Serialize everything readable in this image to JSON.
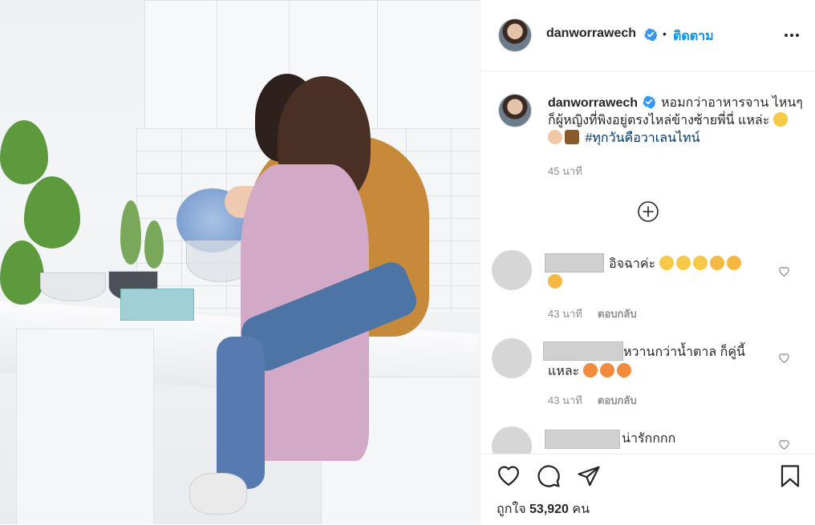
{
  "post": {
    "username": "danworrawech",
    "follow_label": "ติดตาม",
    "separator": "•"
  },
  "caption": {
    "username": "danworrawech",
    "text": "หอมกว่าอาหารจาน ไหนๆ ก็ผู้หญิงที่พิงอยู่ตรงไหล่ข้างซ้ายพี่นี่ แหล่ะ",
    "emojis": [
      "grinning-face",
      "clapping-hands",
      "party-popper"
    ],
    "hashtag": "#ทุกวันคือวาเลนไทน์",
    "time": "45 นาที"
  },
  "comments": [
    {
      "text": "อิจฉาค่ะ",
      "emojis": [
        "rofl",
        "rofl",
        "rofl",
        "grin",
        "grin",
        "grin"
      ],
      "time": "43 นาที",
      "reply": "ตอบกลับ"
    },
    {
      "text": "หวานกว่าน้ำตาล ก็คู่นี้ แหละ",
      "emojis": [
        "kiss",
        "kiss",
        "kiss"
      ],
      "time": "43 นาที",
      "reply": "ตอบกลับ"
    },
    {
      "text": "น่ารักกกก",
      "emojis": [],
      "time": "",
      "reply": ""
    }
  ],
  "likes": {
    "label": "ถูกใจ",
    "count": "53,920",
    "unit": "คน"
  },
  "colors": {
    "accent": "#0095f6",
    "hashtag": "#00376b",
    "muted": "#8e8e8e",
    "text": "#262626"
  },
  "icons": [
    "verified-badge-icon",
    "more-options-icon",
    "load-more-icon",
    "heart-icon",
    "comment-icon",
    "share-icon",
    "bookmark-icon"
  ]
}
